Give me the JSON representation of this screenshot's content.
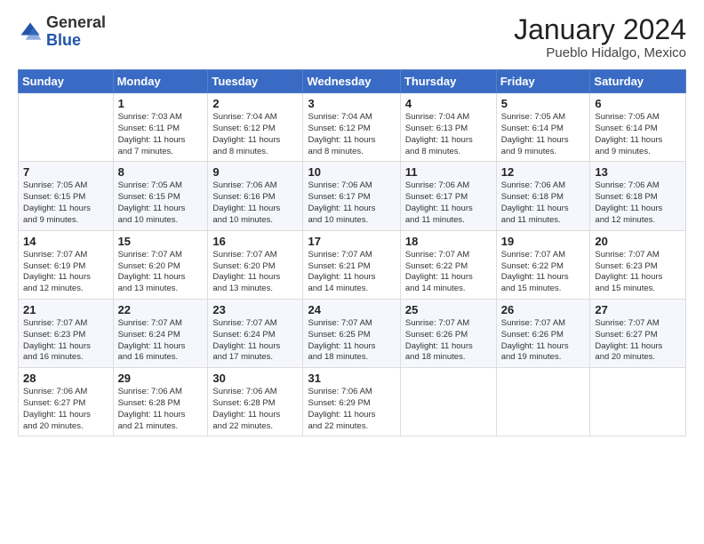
{
  "header": {
    "logo_general": "General",
    "logo_blue": "Blue",
    "month": "January 2024",
    "location": "Pueblo Hidalgo, Mexico"
  },
  "weekdays": [
    "Sunday",
    "Monday",
    "Tuesday",
    "Wednesday",
    "Thursday",
    "Friday",
    "Saturday"
  ],
  "weeks": [
    [
      {
        "day": "",
        "info": ""
      },
      {
        "day": "1",
        "info": "Sunrise: 7:03 AM\nSunset: 6:11 PM\nDaylight: 11 hours\nand 7 minutes."
      },
      {
        "day": "2",
        "info": "Sunrise: 7:04 AM\nSunset: 6:12 PM\nDaylight: 11 hours\nand 8 minutes."
      },
      {
        "day": "3",
        "info": "Sunrise: 7:04 AM\nSunset: 6:12 PM\nDaylight: 11 hours\nand 8 minutes."
      },
      {
        "day": "4",
        "info": "Sunrise: 7:04 AM\nSunset: 6:13 PM\nDaylight: 11 hours\nand 8 minutes."
      },
      {
        "day": "5",
        "info": "Sunrise: 7:05 AM\nSunset: 6:14 PM\nDaylight: 11 hours\nand 9 minutes."
      },
      {
        "day": "6",
        "info": "Sunrise: 7:05 AM\nSunset: 6:14 PM\nDaylight: 11 hours\nand 9 minutes."
      }
    ],
    [
      {
        "day": "7",
        "info": "Sunrise: 7:05 AM\nSunset: 6:15 PM\nDaylight: 11 hours\nand 9 minutes."
      },
      {
        "day": "8",
        "info": "Sunrise: 7:05 AM\nSunset: 6:15 PM\nDaylight: 11 hours\nand 10 minutes."
      },
      {
        "day": "9",
        "info": "Sunrise: 7:06 AM\nSunset: 6:16 PM\nDaylight: 11 hours\nand 10 minutes."
      },
      {
        "day": "10",
        "info": "Sunrise: 7:06 AM\nSunset: 6:17 PM\nDaylight: 11 hours\nand 10 minutes."
      },
      {
        "day": "11",
        "info": "Sunrise: 7:06 AM\nSunset: 6:17 PM\nDaylight: 11 hours\nand 11 minutes."
      },
      {
        "day": "12",
        "info": "Sunrise: 7:06 AM\nSunset: 6:18 PM\nDaylight: 11 hours\nand 11 minutes."
      },
      {
        "day": "13",
        "info": "Sunrise: 7:06 AM\nSunset: 6:18 PM\nDaylight: 11 hours\nand 12 minutes."
      }
    ],
    [
      {
        "day": "14",
        "info": "Sunrise: 7:07 AM\nSunset: 6:19 PM\nDaylight: 11 hours\nand 12 minutes."
      },
      {
        "day": "15",
        "info": "Sunrise: 7:07 AM\nSunset: 6:20 PM\nDaylight: 11 hours\nand 13 minutes."
      },
      {
        "day": "16",
        "info": "Sunrise: 7:07 AM\nSunset: 6:20 PM\nDaylight: 11 hours\nand 13 minutes."
      },
      {
        "day": "17",
        "info": "Sunrise: 7:07 AM\nSunset: 6:21 PM\nDaylight: 11 hours\nand 14 minutes."
      },
      {
        "day": "18",
        "info": "Sunrise: 7:07 AM\nSunset: 6:22 PM\nDaylight: 11 hours\nand 14 minutes."
      },
      {
        "day": "19",
        "info": "Sunrise: 7:07 AM\nSunset: 6:22 PM\nDaylight: 11 hours\nand 15 minutes."
      },
      {
        "day": "20",
        "info": "Sunrise: 7:07 AM\nSunset: 6:23 PM\nDaylight: 11 hours\nand 15 minutes."
      }
    ],
    [
      {
        "day": "21",
        "info": "Sunrise: 7:07 AM\nSunset: 6:23 PM\nDaylight: 11 hours\nand 16 minutes."
      },
      {
        "day": "22",
        "info": "Sunrise: 7:07 AM\nSunset: 6:24 PM\nDaylight: 11 hours\nand 16 minutes."
      },
      {
        "day": "23",
        "info": "Sunrise: 7:07 AM\nSunset: 6:24 PM\nDaylight: 11 hours\nand 17 minutes."
      },
      {
        "day": "24",
        "info": "Sunrise: 7:07 AM\nSunset: 6:25 PM\nDaylight: 11 hours\nand 18 minutes."
      },
      {
        "day": "25",
        "info": "Sunrise: 7:07 AM\nSunset: 6:26 PM\nDaylight: 11 hours\nand 18 minutes."
      },
      {
        "day": "26",
        "info": "Sunrise: 7:07 AM\nSunset: 6:26 PM\nDaylight: 11 hours\nand 19 minutes."
      },
      {
        "day": "27",
        "info": "Sunrise: 7:07 AM\nSunset: 6:27 PM\nDaylight: 11 hours\nand 20 minutes."
      }
    ],
    [
      {
        "day": "28",
        "info": "Sunrise: 7:06 AM\nSunset: 6:27 PM\nDaylight: 11 hours\nand 20 minutes."
      },
      {
        "day": "29",
        "info": "Sunrise: 7:06 AM\nSunset: 6:28 PM\nDaylight: 11 hours\nand 21 minutes."
      },
      {
        "day": "30",
        "info": "Sunrise: 7:06 AM\nSunset: 6:28 PM\nDaylight: 11 hours\nand 22 minutes."
      },
      {
        "day": "31",
        "info": "Sunrise: 7:06 AM\nSunset: 6:29 PM\nDaylight: 11 hours\nand 22 minutes."
      },
      {
        "day": "",
        "info": ""
      },
      {
        "day": "",
        "info": ""
      },
      {
        "day": "",
        "info": ""
      }
    ]
  ]
}
